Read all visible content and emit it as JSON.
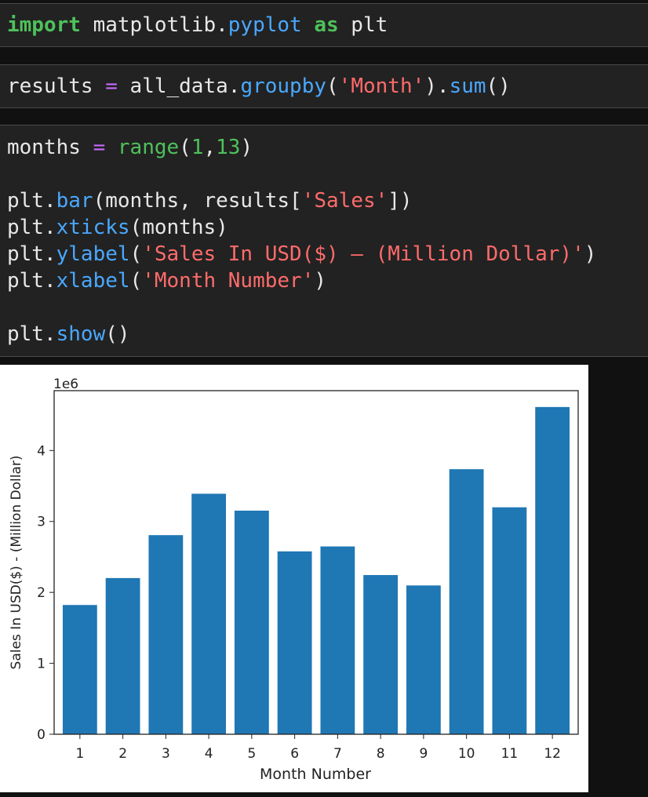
{
  "cells": [
    {
      "lines": [
        [
          [
            "kw",
            "import"
          ],
          [
            "plain",
            " matplotlib."
          ],
          [
            "fn",
            "pyplot"
          ],
          [
            "plain",
            " "
          ],
          [
            "kw",
            "as"
          ],
          [
            "plain",
            " plt"
          ]
        ]
      ]
    },
    {
      "lines": [
        [
          [
            "plain",
            "results "
          ],
          [
            "op",
            "="
          ],
          [
            "plain",
            " all_data."
          ],
          [
            "fn",
            "groupby"
          ],
          [
            "plain",
            "("
          ],
          [
            "str",
            "'Month'"
          ],
          [
            "plain",
            ")."
          ],
          [
            "fn",
            "sum"
          ],
          [
            "plain",
            "()"
          ]
        ]
      ]
    },
    {
      "lines": [
        [
          [
            "plain",
            "months "
          ],
          [
            "op",
            "="
          ],
          [
            "plain",
            " "
          ],
          [
            "bi",
            "range"
          ],
          [
            "plain",
            "("
          ],
          [
            "num",
            "1"
          ],
          [
            "plain",
            ","
          ],
          [
            "num",
            "13"
          ],
          [
            "plain",
            ")"
          ]
        ],
        [],
        [
          [
            "plain",
            "plt."
          ],
          [
            "fn",
            "bar"
          ],
          [
            "plain",
            "(months, results["
          ],
          [
            "str",
            "'Sales'"
          ],
          [
            "plain",
            "])"
          ]
        ],
        [
          [
            "plain",
            "plt."
          ],
          [
            "fn",
            "xticks"
          ],
          [
            "plain",
            "(months)"
          ]
        ],
        [
          [
            "plain",
            "plt."
          ],
          [
            "fn",
            "ylabel"
          ],
          [
            "plain",
            "("
          ],
          [
            "str",
            "'Sales In USD($) – (Million Dollar)'"
          ],
          [
            "plain",
            ")"
          ]
        ],
        [
          [
            "plain",
            "plt."
          ],
          [
            "fn",
            "xlabel"
          ],
          [
            "plain",
            "("
          ],
          [
            "str",
            "'Month Number'"
          ],
          [
            "plain",
            ")"
          ]
        ],
        [],
        [
          [
            "plain",
            "plt."
          ],
          [
            "fn",
            "show"
          ],
          [
            "plain",
            "()"
          ]
        ]
      ]
    }
  ],
  "chart_data": {
    "type": "bar",
    "categories": [
      "1",
      "2",
      "3",
      "4",
      "5",
      "6",
      "7",
      "8",
      "9",
      "10",
      "11",
      "12"
    ],
    "values": [
      1822256.73,
      2202022.42,
      2807100.38,
      3390670.24,
      3152606.75,
      2577802.26,
      2647775.76,
      2244467.88,
      2097560.13,
      3736726.88,
      3199603.2,
      4613443.34
    ],
    "xlabel": "Month Number",
    "ylabel": "Sales In USD($) - (Million Dollar)",
    "offset_text": "1e6",
    "yticks": [
      "0",
      "1",
      "2",
      "3",
      "4"
    ],
    "ylim": [
      0,
      4844115.5
    ],
    "bar_color": "#1f77b4"
  }
}
